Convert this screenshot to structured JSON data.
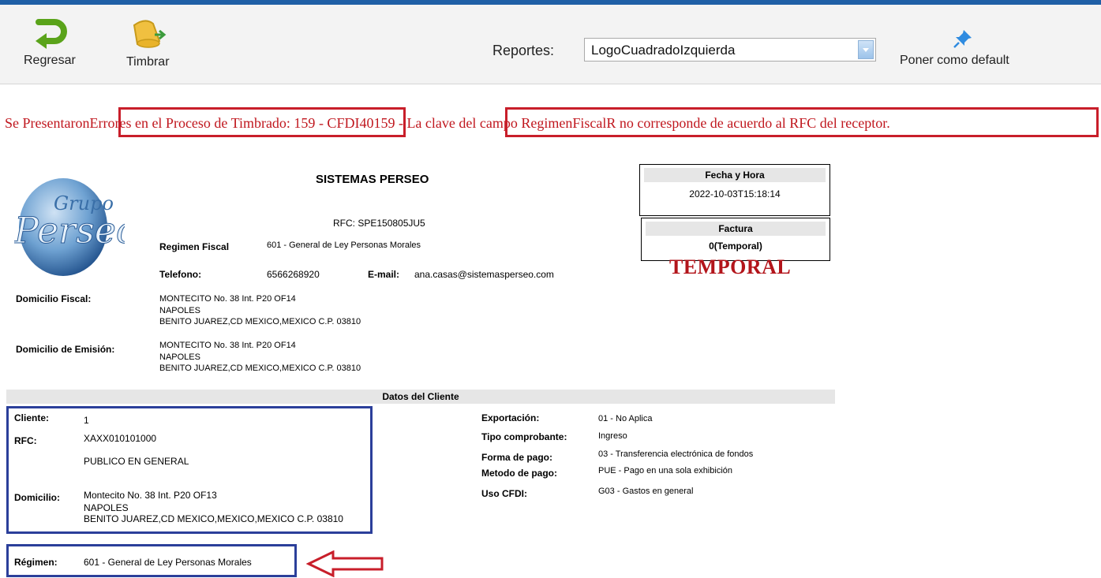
{
  "toolbar": {
    "back_label": "Regresar",
    "stamp_label": "Timbrar",
    "reports_label": "Reportes:",
    "reports_selected": "LogoCuadradoIzquierda",
    "set_default_label": "Poner como default"
  },
  "error": {
    "prefix": "Se Presentaron",
    "part1": "Errores en el Proceso de Timbrado: 159",
    "sep": " - CFDI40159 - ",
    "part2": "La clave del campo RegimenFiscalR no corresponde de acuerdo al RFC del receptor."
  },
  "logo": {
    "text1": "Grupo",
    "text2": "Perseo"
  },
  "emitter": {
    "name": "SISTEMAS PERSEO",
    "rfc": "RFC: SPE150805JU5",
    "regimen_label": "Regimen Fiscal",
    "regimen_value": "601 - General de Ley Personas Morales",
    "phone_label": "Telefono:",
    "phone_value": "6566268920",
    "email_label": "E-mail:",
    "email_value": "ana.casas@sistemasperseo.com",
    "fiscal_address_label": "Domicilio Fiscal:",
    "fiscal_address": [
      "MONTECITO No. 38 Int. P20 OF14",
      "NAPOLES",
      "BENITO JUAREZ,CD MEXICO,MEXICO C.P. 03810"
    ],
    "issue_address_label": "Domicilio de Emisión:",
    "issue_address": [
      "MONTECITO No. 38 Int. P20 OF14",
      "NAPOLES",
      "BENITO JUAREZ,CD MEXICO,MEXICO C.P. 03810"
    ]
  },
  "datebox": {
    "header": "Fecha y Hora",
    "value": "2022-10-03T15:18:14"
  },
  "invoicebox": {
    "header": "Factura",
    "value": "0(Temporal)"
  },
  "watermark": "TEMPORAL",
  "client": {
    "section_title": "Datos del Cliente",
    "client_label": "Cliente:",
    "client_value": "1",
    "rfc_label": "RFC:",
    "rfc_value": "XAXX010101000",
    "name": "PUBLICO EN GENERAL",
    "address_label": "Domicilio:",
    "address": [
      "Montecito No. 38 Int. P20 OF13",
      "NAPOLES",
      "BENITO JUAREZ,CD MEXICO,MEXICO,MEXICO C.P. 03810"
    ],
    "regimen_label": "Régimen:",
    "regimen_value": "601 - General de Ley Personas Morales"
  },
  "details": {
    "export_label": "Exportación:",
    "export_value": "01 - No Aplica",
    "type_label": "Tipo comprobante:",
    "type_value": "Ingreso",
    "payment_form_label": "Forma de pago:",
    "payment_form_value": "03 - Transferencia electrónica de fondos",
    "payment_method_label": "Metodo de pago:",
    "payment_method_value": "PUE - Pago en una sola exhibición",
    "cfdi_use_label": "Uso CFDI:",
    "cfdi_use_value": "G03 - Gastos en general"
  },
  "colors": {
    "error_red": "#c0171e",
    "annot_red": "#c81e2a",
    "annot_blue": "#2b3f9a",
    "top_bar": "#1f5fa6"
  }
}
